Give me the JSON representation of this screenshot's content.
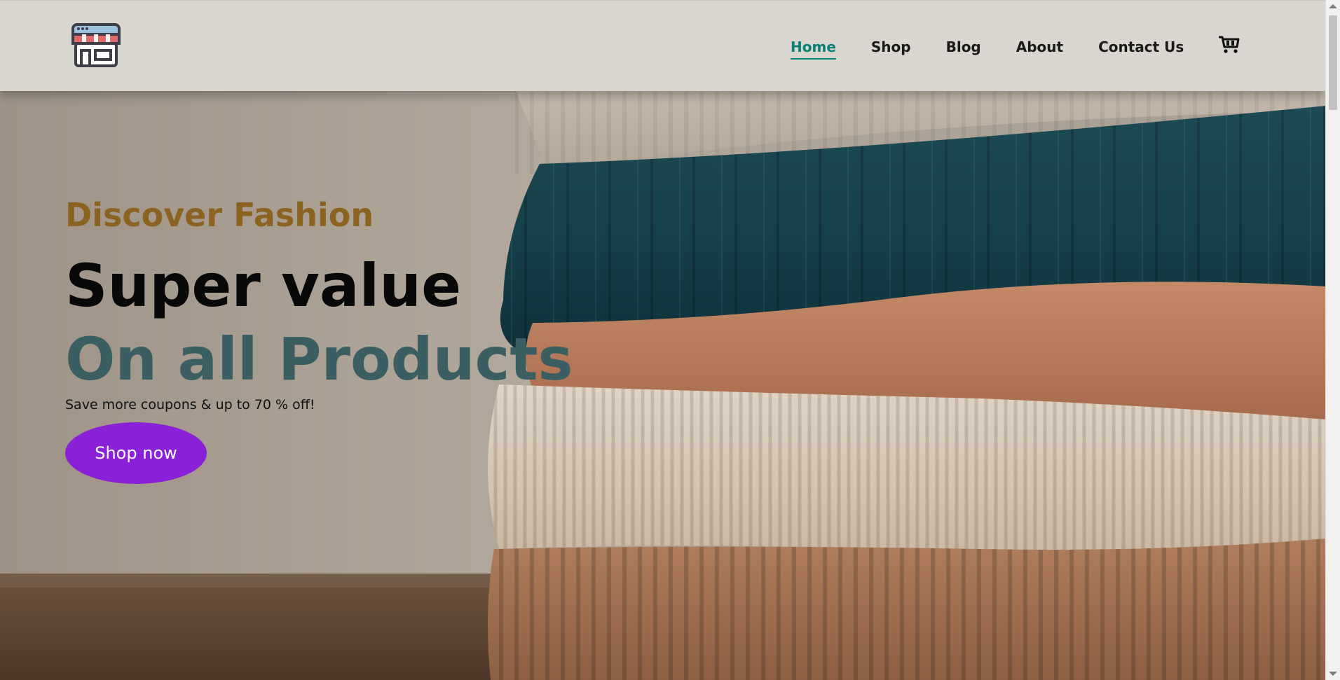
{
  "header": {
    "logo_icon": "storefront-icon",
    "nav": [
      {
        "label": "Home",
        "active": true
      },
      {
        "label": "Shop",
        "active": false
      },
      {
        "label": "Blog",
        "active": false
      },
      {
        "label": "About",
        "active": false
      },
      {
        "label": "Contact Us",
        "active": false
      }
    ],
    "cart_icon": "shopping-cart-icon"
  },
  "hero": {
    "eyebrow": "Discover Fashion",
    "headline": "Super value",
    "headline_accent": "On all Products",
    "subtext": "Save more coupons & up to 70 % off!",
    "cta_label": "Shop now",
    "background_image": "folded-knit-sweaters-stack"
  },
  "colors": {
    "header_bg": "#d9d5cf",
    "accent_active": "#088178",
    "eyebrow": "#8b6320",
    "headline": "#080808",
    "headline_accent": "#3a5e62",
    "cta_bg": "#8a21d6",
    "cta_text": "#ffffff"
  }
}
